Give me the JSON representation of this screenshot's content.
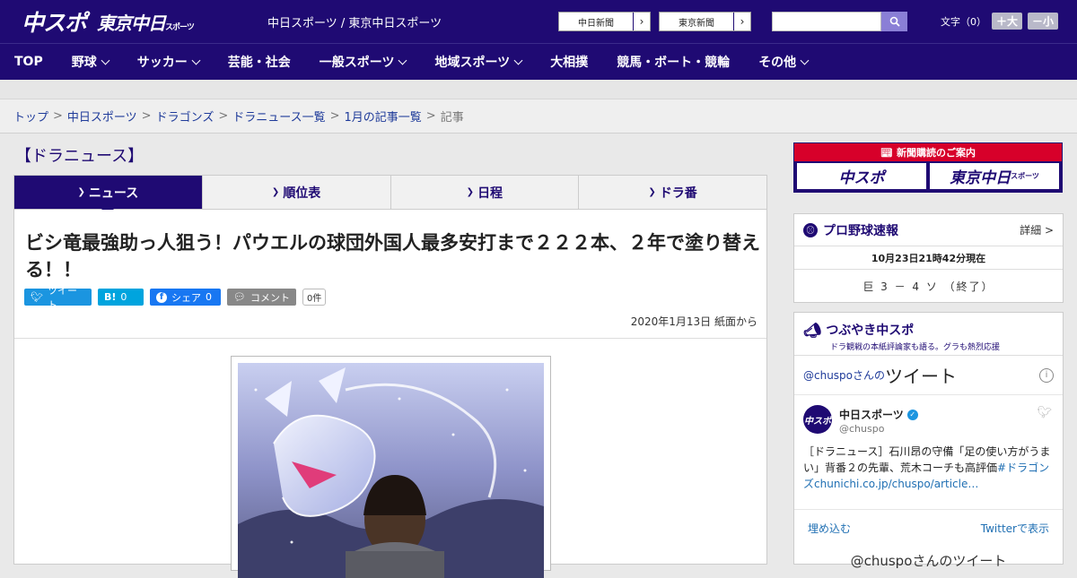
{
  "header": {
    "logo_main": "中スポ",
    "logo_tokyo": "東京中日",
    "logo_tokyo_small": "スポーツ",
    "site_name": "中日スポーツ / 東京中日スポーツ",
    "ext_links": [
      {
        "label": "中日新聞"
      },
      {
        "label": "東京新聞"
      }
    ],
    "search_placeholder": "",
    "font_size_label": "文字（0）",
    "font_plus": "＋大",
    "font_minus": "－小"
  },
  "nav": {
    "items": [
      {
        "label": "TOP"
      },
      {
        "label": "野球"
      },
      {
        "label": "サッカー"
      },
      {
        "label": "芸能・社会"
      },
      {
        "label": "一般スポーツ"
      },
      {
        "label": "地域スポーツ"
      },
      {
        "label": "大相撲"
      },
      {
        "label": "競馬・ボート・競輪"
      },
      {
        "label": "その他"
      }
    ]
  },
  "breadcrumb": {
    "items": [
      "トップ",
      "中日スポーツ",
      "ドラゴンズ",
      "ドラニュース一覧",
      "1月の記事一覧"
    ],
    "current": "記事",
    "sep": ">"
  },
  "main": {
    "section_title": "【ドラニュース】",
    "tabs": [
      {
        "label": "ニュース"
      },
      {
        "label": "順位表"
      },
      {
        "label": "日程"
      },
      {
        "label": "ドラ番"
      }
    ],
    "headline": "ビシ竜最強助っ人狙う！パウエルの球団外国人最多安打まで２２２本、２年で塗り替える！！",
    "social": {
      "tweet": "ツイート",
      "hatena": "B!",
      "hatena_count": "0",
      "share": "シェア",
      "share_count": "0",
      "comment": "コメント",
      "comment_count": "0件"
    },
    "date": "2020年1月13日 紙面から"
  },
  "sidebar": {
    "ad": {
      "title": "新聞購読のご案内",
      "box1": "中スポ",
      "box2": "東京中日",
      "box2_small": "スポーツ"
    },
    "baseball": {
      "title": "プロ野球速報",
      "more": "詳細 >",
      "time": "10月23日21時42分現在",
      "score": "巨 3 － 4 ソ （終了）"
    },
    "tweets": {
      "title": "つぶやき中スポ",
      "subtitle": "ドラ観戦の本紙評論家も語る。グラも熱烈応援",
      "account": "@chuspoさんの",
      "word": "ツイート",
      "user": "中日スポーツ",
      "handle": "@chuspo",
      "text": "［ドラニュース］石川昂の守備「足の使い方がうまい」背番２の先輩、荒木コーチも高評価",
      "hashtag": "#ドラゴンズ",
      "link": "chunichi.co.jp/chuspo/article…",
      "embed": "埋め込む",
      "view_on": "Twitterで表示",
      "more": "@chuspoさんのツイート"
    }
  }
}
